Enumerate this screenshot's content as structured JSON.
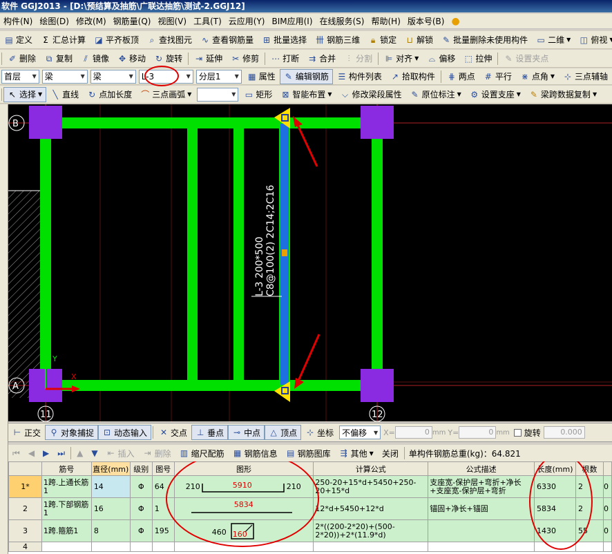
{
  "window": {
    "title": "软件 GGJ2013 - [D:\\预结算及抽筋\\广联达抽筋\\测试-2.GGJ12]"
  },
  "menu": [
    "构件(N)",
    "绘图(D)",
    "修改(M)",
    "钢筋量(Q)",
    "视图(V)",
    "工具(T)",
    "云应用(Y)",
    "BIM应用(I)",
    "在线服务(S)",
    "帮助(H)",
    "版本号(B)"
  ],
  "toolbar1": {
    "define": "定义",
    "sum": "汇总计算",
    "slab": "平齐板顶",
    "find": "查找图元",
    "view_rebar": "查看钢筋量",
    "batch_select": "批量选择",
    "rebar3d": "钢筋三维",
    "lock": "锁定",
    "unlock": "解锁",
    "batch_delete": "批量删除未使用构件",
    "view2d": "二维",
    "view_top": "俯视"
  },
  "toolbar2": {
    "delete": "删除",
    "copy": "复制",
    "mirror": "镜像",
    "move": "移动",
    "rotate": "旋转",
    "extend": "延伸",
    "trim": "修剪",
    "break": "打断",
    "merge": "合并",
    "split": "分割",
    "align": "对齐",
    "offset": "偏移",
    "stretch": "拉伸",
    "set_point": "设置夹点"
  },
  "toolbar3": {
    "floor": "首层",
    "type1": "梁",
    "type2": "梁",
    "member": "L-3",
    "layer": "分层1",
    "property": "属性",
    "edit_rebar": "编辑钢筋",
    "member_list": "构件列表",
    "pick": "拾取构件",
    "two_point": "两点",
    "parallel": "平行",
    "point_angle": "点角",
    "three_point": "三点辅轴"
  },
  "toolbar4": {
    "select": "选择",
    "line": "直线",
    "point_len": "点加长度",
    "arc": "三点画弧",
    "arc_combo": "",
    "rect": "矩形",
    "smart": "智能布置",
    "modify_span": "修改梁段属性",
    "orig_mark": "原位标注",
    "support": "设置支座",
    "span_copy": "梁跨数据复制"
  },
  "canvas": {
    "axis_b": "B",
    "axis_a": "A",
    "axis_11": "11",
    "axis_12": "12",
    "beam_label_1": "L-3 200*500",
    "beam_label_2": "C8@100(2) 2C14;2C16",
    "y_label": "Y",
    "x_label": "X",
    "colors": {
      "beam": "#00e000",
      "selected": "#1e6fe0",
      "column": "#8a2be2",
      "arrow": "#e00000"
    }
  },
  "snap": {
    "ortho": "正交",
    "obj_snap": "对象捕捉",
    "dyn_input": "动态输入",
    "intersection": "交点",
    "perp": "垂点",
    "mid": "中点",
    "vertex": "顶点",
    "coord": "坐标",
    "offset_mode": "不偏移",
    "x_label": "X=",
    "x_val": "0",
    "x_unit": "mm",
    "y_label": "Y=",
    "y_val": "0",
    "y_unit": "mm",
    "rotate": "旋转",
    "rotate_val": "0.000"
  },
  "rebar_bar": {
    "insert": "插入",
    "delete": "删除",
    "scale": "缩尺配筋",
    "info": "钢筋信息",
    "library": "钢筋图库",
    "other": "其他",
    "close": "关闭",
    "total_label": "单构件钢筋总重(kg)：64.821"
  },
  "grid": {
    "headers": [
      "",
      "筋号",
      "直径(mm)",
      "级别",
      "图号",
      "图形",
      "计算公式",
      "公式描述",
      "长度(mm)",
      "根数",
      ""
    ],
    "rows": [
      {
        "num": "1*",
        "name": "1跨.上通长筋1",
        "dia": "14",
        "grade": "Φ",
        "fig": "64",
        "shape_left": "210",
        "shape_mid": "5910",
        "shape_right": "210",
        "formula": "250-20+15*d+5450+250-20+15*d",
        "desc": "支座宽-保护层+弯折+净长+支座宽-保护层+弯折",
        "length": "6330",
        "count": "2",
        "extra": "0"
      },
      {
        "num": "2",
        "name": "1跨.下部钢筋1",
        "dia": "16",
        "grade": "Φ",
        "fig": "1",
        "shape_mid": "5834",
        "formula": "12*d+5450+12*d",
        "desc": "锚固+净长+锚固",
        "length": "5834",
        "count": "2",
        "extra": "0"
      },
      {
        "num": "3",
        "name": "1跨.箍筋1",
        "dia": "8",
        "grade": "Φ",
        "fig": "195",
        "shape_left": "460",
        "shape_mid": "160",
        "formula": "2*((200-2*20)+(500-2*20))+2*(11.9*d)",
        "desc": "",
        "length": "1430",
        "count": "55",
        "extra": "0"
      },
      {
        "num": "4"
      }
    ]
  }
}
